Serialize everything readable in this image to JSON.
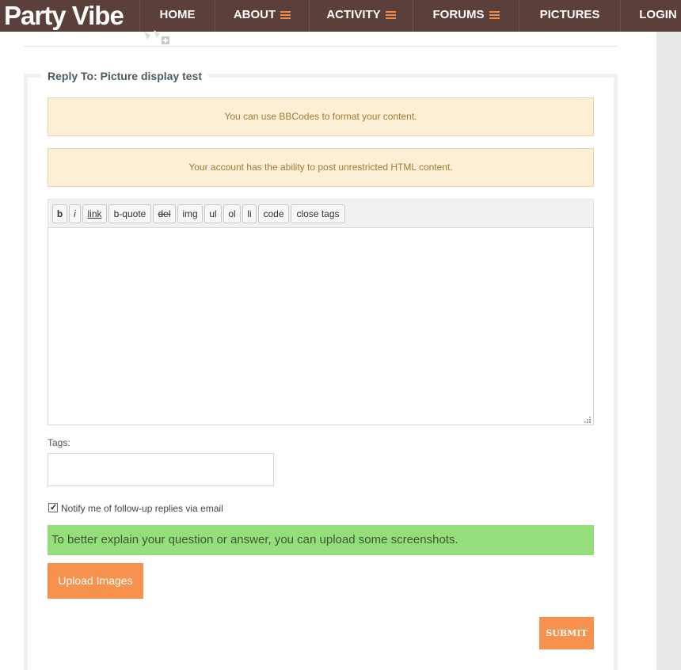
{
  "header": {
    "logo": "Party Vibe",
    "nav": [
      {
        "label": "HOME"
      },
      {
        "label": "ABOUT"
      },
      {
        "label": "ACTIVITY"
      },
      {
        "label": "FORUMS"
      },
      {
        "label": "PICTURES"
      },
      {
        "label": "LOGIN"
      }
    ]
  },
  "form": {
    "legend": "Reply To: Picture display test",
    "notices": [
      "You can use BBCodes to format your content.",
      "Your account has the ability to post unrestricted HTML content."
    ],
    "toolbar": [
      "b",
      "i",
      "link",
      "b-quote",
      "del",
      "img",
      "ul",
      "ol",
      "li",
      "code",
      "close tags"
    ],
    "editor_value": "",
    "tags_label": "Tags:",
    "tags_value": "",
    "notify_label": "Notify me of follow-up replies via email",
    "notify_checked": true,
    "upload_hint": "To better explain your question or answer, you can upload some screenshots.",
    "upload_button": "Upload Images",
    "submit_button": "SUBMIT"
  },
  "colors": {
    "nav_bg": "#5b3f3a",
    "accent": "#f6914e",
    "notice_bg": "#fcefd6",
    "hint_bg": "#94de7b"
  }
}
